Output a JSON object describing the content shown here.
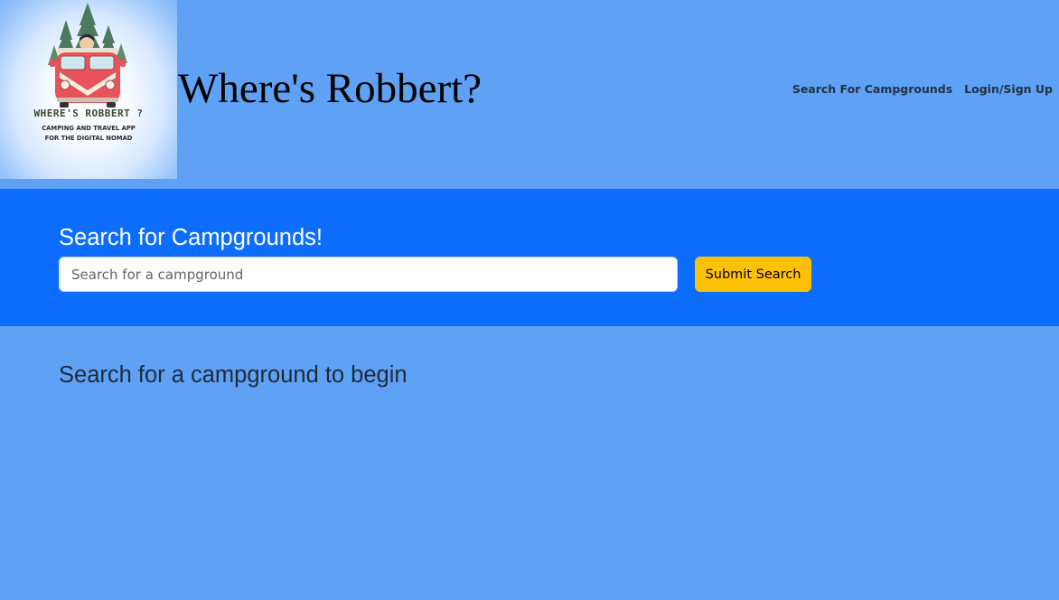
{
  "header": {
    "logo": {
      "title_text": "WHERE'S ROBBERT ?",
      "tagline_line1": "CAMPING AND TRAVEL APP",
      "tagline_line2": "FOR THE DIGITAL NOMAD"
    },
    "site_title": "Where's Robbert?",
    "nav": [
      {
        "label": "Search For Campgrounds"
      },
      {
        "label": "Login/Sign Up"
      }
    ]
  },
  "search": {
    "heading": "Search for Campgrounds!",
    "input_value": "",
    "placeholder": "Search for a campground",
    "submit_label": "Submit Search"
  },
  "main": {
    "empty_message": "Search for a campground to begin"
  },
  "colors": {
    "page_background": "#5fa1f4",
    "banner_background": "#0d6efd",
    "button_background": "#ffc107",
    "logo_bus": "#e8525a",
    "logo_text": "#3b4a2e"
  }
}
